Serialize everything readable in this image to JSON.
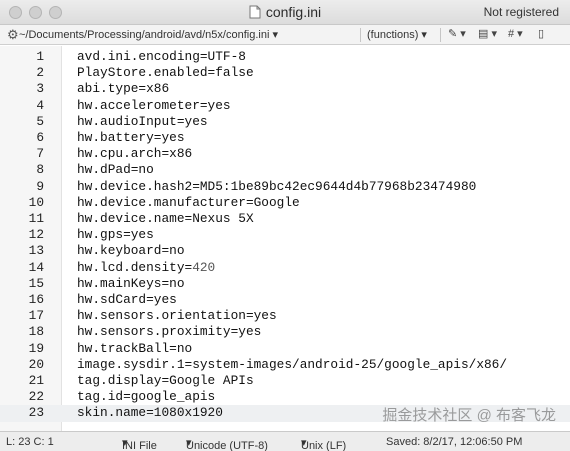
{
  "window": {
    "title": "config.ini",
    "registration": "Not registered"
  },
  "toolbar": {
    "path": "~/Documents/Processing/android/avd/n5x/config.ini",
    "functions": "(functions)"
  },
  "editor": {
    "current_line": 23,
    "lines": [
      {
        "n": "1",
        "text": "avd.ini.encoding=UTF-8"
      },
      {
        "n": "2",
        "text": "PlayStore.enabled=false"
      },
      {
        "n": "3",
        "text": "abi.type=x86"
      },
      {
        "n": "4",
        "text": "hw.accelerometer=yes"
      },
      {
        "n": "5",
        "text": "hw.audioInput=yes"
      },
      {
        "n": "6",
        "text": "hw.battery=yes"
      },
      {
        "n": "7",
        "text": "hw.cpu.arch=x86"
      },
      {
        "n": "8",
        "text": "hw.dPad=no"
      },
      {
        "n": "9",
        "text": "hw.device.hash2=MD5:1be89bc42ec9644d4b77968b23474980"
      },
      {
        "n": "10",
        "text": "hw.device.manufacturer=Google"
      },
      {
        "n": "11",
        "text": "hw.device.name=Nexus 5X"
      },
      {
        "n": "12",
        "text": "hw.gps=yes"
      },
      {
        "n": "13",
        "text": "hw.keyboard=no"
      },
      {
        "n": "14",
        "text": "hw.lcd.density=",
        "tail": "420"
      },
      {
        "n": "15",
        "text": "hw.mainKeys=no"
      },
      {
        "n": "16",
        "text": "hw.sdCard=yes"
      },
      {
        "n": "17",
        "text": "hw.sensors.orientation=yes"
      },
      {
        "n": "18",
        "text": "hw.sensors.proximity=yes"
      },
      {
        "n": "19",
        "text": "hw.trackBall=no"
      },
      {
        "n": "20",
        "text": "image.sysdir.1=system-images/android-25/google_apis/x86/"
      },
      {
        "n": "21",
        "text": "tag.display=Google APIs"
      },
      {
        "n": "22",
        "text": "tag.id=google_apis"
      },
      {
        "n": "23",
        "text": "skin.name=1080x1920"
      }
    ]
  },
  "watermark": "掘金技术社区 @ 布客飞龙",
  "status": {
    "position": "L: 23 C: 1",
    "file_type": "INI File",
    "encoding": "Unicode (UTF-8)",
    "line_endings": "Unix (LF)",
    "saved": "Saved: 8/2/17, 12:06:50 PM"
  },
  "icons": {
    "gear": "gear-icon",
    "pen": "pen-icon",
    "stamp": "stamp-icon",
    "hash": "hash-icon",
    "page": "page-icon",
    "document": "document-icon"
  }
}
